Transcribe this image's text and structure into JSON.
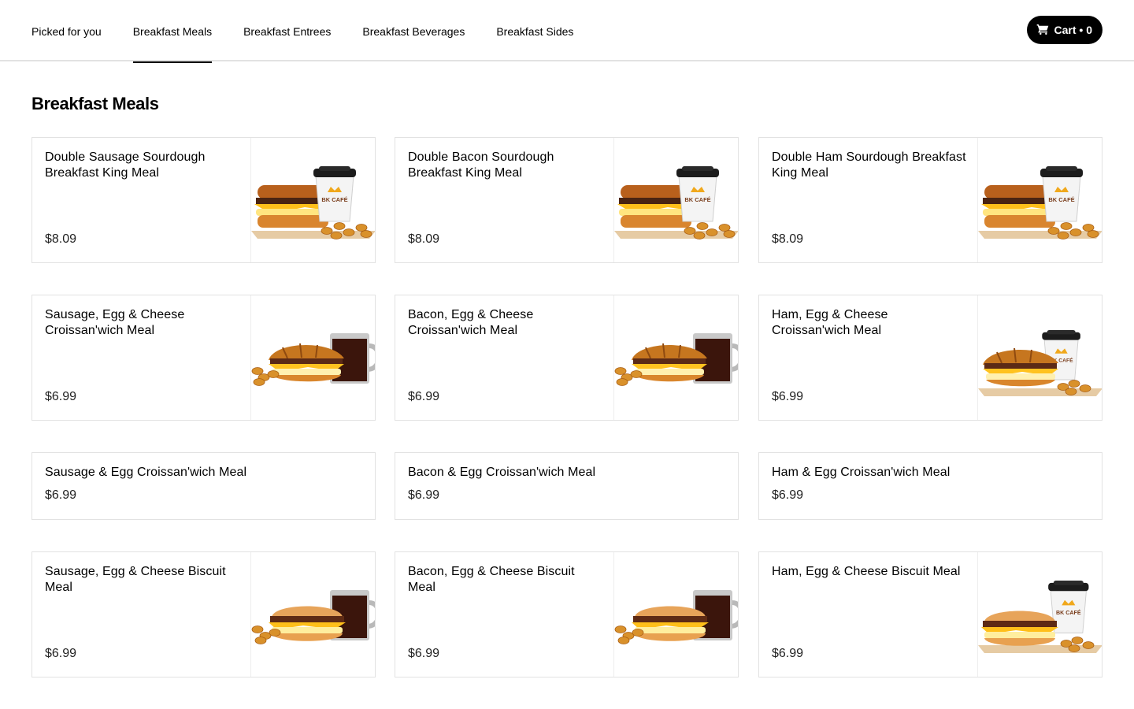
{
  "nav": {
    "tabs": [
      {
        "label": "Picked for you"
      },
      {
        "label": "Breakfast Meals"
      },
      {
        "label": "Breakfast Entrees"
      },
      {
        "label": "Breakfast Beverages"
      },
      {
        "label": "Breakfast Sides"
      }
    ],
    "active_tab": "Breakfast Meals"
  },
  "cart": {
    "icon": "cart-icon",
    "label": "Cart • 0"
  },
  "section": {
    "title": "Breakfast Meals"
  },
  "items": [
    {
      "name": "Double Sausage Sourdough Breakfast King Meal",
      "price": "$8.09",
      "image": "sourdough-meal-coffee"
    },
    {
      "name": "Double Bacon Sourdough Breakfast King Meal",
      "price": "$8.09",
      "image": "sourdough-meal-coffee"
    },
    {
      "name": "Double Ham Sourdough Breakfast King Meal",
      "price": "$8.09",
      "image": "sourdough-meal-coffee"
    },
    {
      "name": "Sausage, Egg & Cheese Croissan'wich Meal",
      "price": "$6.99",
      "image": "croissant-meal-mug"
    },
    {
      "name": "Bacon, Egg & Cheese Croissan'wich Meal",
      "price": "$6.99",
      "image": "croissant-meal-mug"
    },
    {
      "name": "Ham, Egg & Cheese Croissan'wich Meal",
      "price": "$6.99",
      "image": "croissant-meal-coffee"
    },
    {
      "name": "Sausage & Egg Croissan'wich Meal",
      "price": "$6.99",
      "image": null
    },
    {
      "name": "Bacon & Egg Croissan'wich Meal",
      "price": "$6.99",
      "image": null
    },
    {
      "name": "Ham & Egg Croissan'wich Meal",
      "price": "$6.99",
      "image": null
    },
    {
      "name": "Sausage, Egg & Cheese Biscuit Meal",
      "price": "$6.99",
      "image": "biscuit-meal-mug"
    },
    {
      "name": "Bacon, Egg & Cheese Biscuit Meal",
      "price": "$6.99",
      "image": "biscuit-meal-mug"
    },
    {
      "name": "Ham, Egg & Cheese Biscuit Meal",
      "price": "$6.99",
      "image": "biscuit-meal-coffee"
    }
  ],
  "cup_text": "BK CAFÉ",
  "colors": {
    "accent": "#000000",
    "border": "#e2e2e2",
    "price": "#222222"
  }
}
